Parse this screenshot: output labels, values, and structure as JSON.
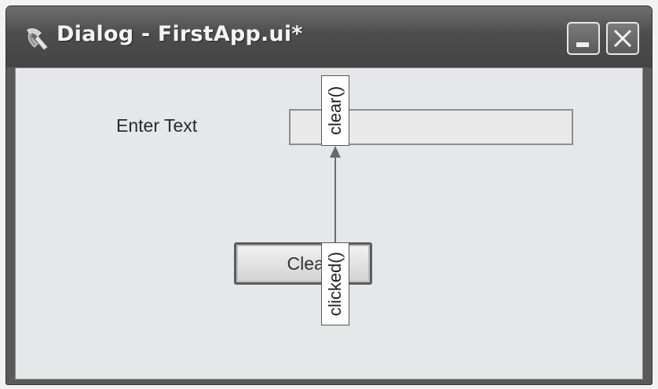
{
  "window": {
    "title": "Dialog - FirstApp.ui*",
    "icon": "qt-designer-icon"
  },
  "titlebar_buttons": {
    "minimize": "minimize-icon",
    "close": "close-icon"
  },
  "form": {
    "label_text": "Enter Text",
    "line_edit_value": "",
    "button_label": "Clear"
  },
  "connection": {
    "signal": "clicked()",
    "slot": "clear()"
  }
}
